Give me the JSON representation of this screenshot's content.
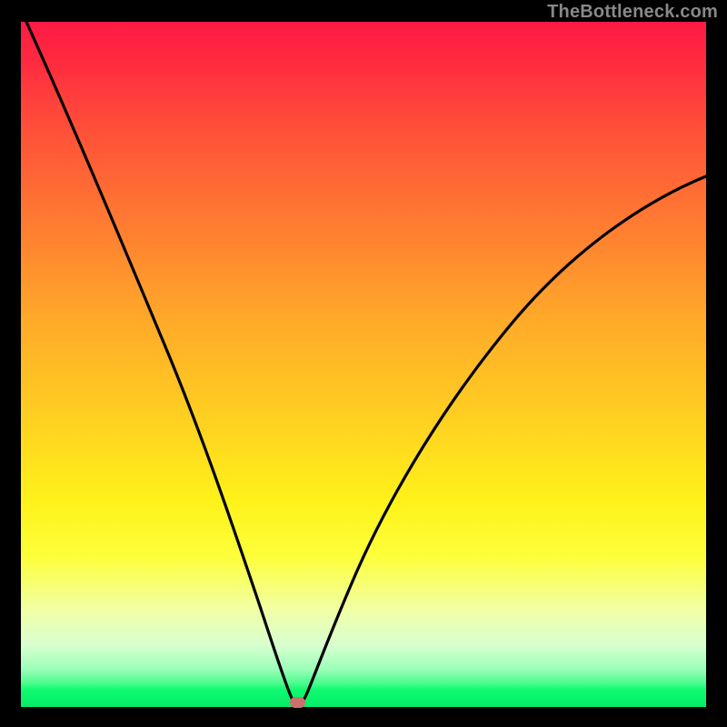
{
  "watermark": "TheBottleneck.com",
  "colors": {
    "frame": "#000000",
    "watermark": "#888888",
    "curve": "#000000",
    "marker": "#cc6f6f",
    "gradient_top": "#ff1a44",
    "gradient_bottom": "#04ec69"
  },
  "chart_data": {
    "type": "line",
    "title": "",
    "xlabel": "",
    "ylabel": "",
    "xlim": [
      0,
      100
    ],
    "ylim": [
      0,
      100
    ],
    "x": [
      0,
      5,
      10,
      15,
      20,
      25,
      30,
      33,
      36,
      38,
      39.5,
      40.5,
      41.5,
      44,
      48,
      55,
      63,
      72,
      82,
      92,
      100
    ],
    "values": [
      100,
      90,
      80,
      69,
      57,
      44,
      30,
      19,
      8,
      2,
      0.3,
      0.3,
      2,
      7,
      15,
      27,
      39,
      50,
      60,
      69,
      74
    ],
    "series": [
      {
        "name": "bottleneck-curve",
        "values": [
          100,
          90,
          80,
          69,
          57,
          44,
          30,
          19,
          8,
          2,
          0.3,
          0.3,
          2,
          7,
          15,
          27,
          39,
          50,
          60,
          69,
          74
        ]
      }
    ],
    "marker": {
      "x": 40,
      "y": 0
    },
    "annotations": []
  }
}
